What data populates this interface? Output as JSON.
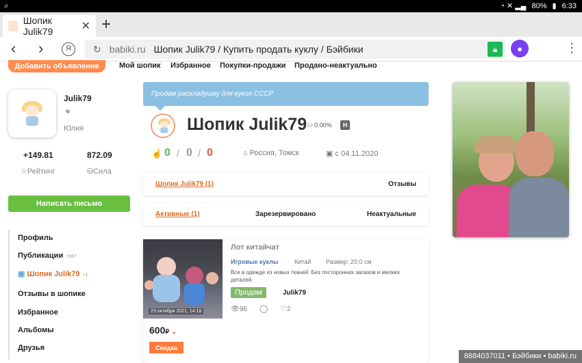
{
  "statusbar": {
    "battery": "80%",
    "time": "6:33"
  },
  "browser": {
    "tab_title": "Шопик Julik79",
    "tab_close": "✕",
    "new_tab": "+",
    "url_domain": "babiki.ru",
    "url_title": "Шопик Julik79 / Купить продать куклу / Бэйбики"
  },
  "site_nav": {
    "add_button": "Добавить объявление",
    "links": [
      "Мой шопик",
      "Избранное",
      "Покупки-продажи",
      "Продано-неактуально"
    ]
  },
  "profile": {
    "username": "Julik79",
    "name": "Юлия",
    "rating_value": "+149.81",
    "rating_label": "Рейтинг",
    "power_value": "872.09",
    "power_label": "Сила",
    "write_button": "Написать письмо"
  },
  "side_menu": [
    {
      "label": "Профиль",
      "count": ""
    },
    {
      "label": "Публикации",
      "count": "+587"
    },
    {
      "label": "Шопик Julik79",
      "count": "+1"
    },
    {
      "label": "Отзывы в шопике",
      "count": ""
    },
    {
      "label": "Избранное",
      "count": ""
    },
    {
      "label": "Альбомы",
      "count": ""
    },
    {
      "label": "Друзья",
      "count": ""
    }
  ],
  "shop": {
    "banner": "Продам раскладушку для кукол СССР",
    "title": "Шопик Julik79",
    "percent": "0.00%",
    "h_badge": "H",
    "votes": [
      "0",
      "0",
      "0"
    ],
    "separator": "/",
    "location": "Россия, Томск",
    "since": "с 04.11.2020"
  },
  "tabs_row1": {
    "active": "Шопик Julik79 (1)",
    "other": "Отзывы"
  },
  "tabs_row2": {
    "active": "Активные (1)",
    "reserved": "Зарезервировано",
    "inactive": "Неактуальные"
  },
  "listing": {
    "title": "Лот китайчат",
    "category": "Игровые куклы",
    "origin": "Китай",
    "size": "Размер: 20.0 см",
    "description": "Все в одежде из новых тканей. Без посторонних запахов и мелких деталей.",
    "badge": "Продам",
    "seller": "Julik79",
    "views": "96",
    "likes": "2",
    "date": "23 октября 2021, 14:18",
    "price": "600",
    "currency": "₽",
    "sale_label": "Скидка"
  },
  "watermark": "8884037011 • Бэйбики • babiki.ru",
  "colors": {
    "accent": "#e06a1e",
    "green": "#6abf40",
    "banner": "#8cc0e3",
    "vote_green": "#5ab552",
    "vote_red": "#e0544a"
  }
}
